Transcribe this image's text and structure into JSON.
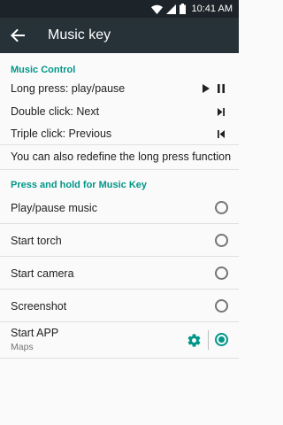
{
  "status_bar": {
    "time": "10:41 AM"
  },
  "app_bar": {
    "title": "Music key"
  },
  "music_control": {
    "header": "Music Control",
    "rows": [
      {
        "label": "Long press: play/pause"
      },
      {
        "label": "Double click: Next"
      },
      {
        "label": "Triple click: Previous"
      }
    ],
    "note": "You can also redefine the long press function"
  },
  "press_hold": {
    "header": "Press and hold for Music Key",
    "options": [
      {
        "label": "Play/pause music",
        "checked": false
      },
      {
        "label": "Start torch",
        "checked": false
      },
      {
        "label": "Start camera",
        "checked": false
      },
      {
        "label": "Screenshot",
        "checked": false
      },
      {
        "label": "Start APP",
        "sublabel": "Maps",
        "checked": true
      }
    ]
  },
  "colors": {
    "accent": "#009688",
    "app_bar": "#263238",
    "status_bar": "#1c2429"
  }
}
